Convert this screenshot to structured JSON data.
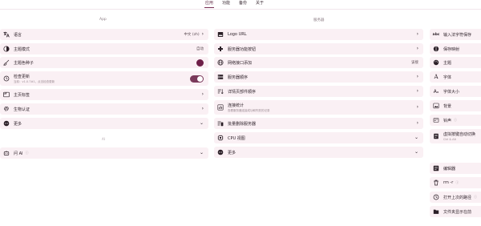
{
  "tabs": [
    {
      "label": "应用",
      "active": true
    },
    {
      "label": "功能"
    },
    {
      "label": "备份"
    },
    {
      "label": "关于"
    }
  ],
  "columns": {
    "left_title": "App",
    "middle_title": "服务器"
  },
  "left": {
    "language": {
      "label": "语言",
      "value": "中文 (zh)"
    },
    "theme_mode": {
      "label": "主题模式",
      "value": "自动"
    },
    "theme_color": {
      "label": "主题色种子",
      "color": "#6e1f48"
    },
    "check_update": {
      "label": "检查更新",
      "sub": "当前：v1.0.7#1，点击检查更新",
      "enabled": true
    },
    "home_tab": {
      "label": "主页标签"
    },
    "bio_auth": {
      "label": "生物认证"
    },
    "more": {
      "label": "更多"
    },
    "divider_text": "AI",
    "ai": {
      "label": "问 AI",
      "help": "ⓘ"
    }
  },
  "middle": {
    "logo_url": {
      "label": "Logo URL"
    },
    "server_functions": {
      "label": "服务器功能按钮"
    },
    "net_iface": {
      "label": "网络接口添加",
      "value": "该接"
    },
    "server_order": {
      "label": "服务器顺序"
    },
    "detail_order": {
      "label": "详情页部件顺序"
    },
    "history": {
      "label": "连接统计",
      "sub": "查看服务器连接成功和失败的记录"
    },
    "batch_delete": {
      "label": "批量删除服务器"
    },
    "cpu_view": {
      "label": "CPU 视图"
    },
    "more": {
      "label": "更多"
    }
  },
  "right": {
    "items": [
      {
        "label": "输入法字符保存",
        "icon": "abc-icon"
      },
      {
        "label": "保存映射",
        "icon": "map-icon"
      },
      {
        "label": "主题",
        "icon": "palette-icon"
      },
      {
        "label": "字体",
        "icon": "font-icon"
      },
      {
        "label": "字体大小",
        "icon": "font-size-icon"
      },
      {
        "label": "背景",
        "icon": "image-icon"
      },
      {
        "label": "铃声",
        "icon": "bell-icon",
        "help": "ⓘ"
      },
      {
        "label": "虚拟按键自动切换",
        "icon": "keyboard-icon",
        "sub": "Ctrl & Alt"
      },
      {
        "label": "编辑器",
        "icon": "editor-icon"
      },
      {
        "label": "rm -r",
        "icon": "trash-icon",
        "help": "ⓘ"
      },
      {
        "label": "打开上次的路径",
        "icon": "history-icon",
        "help": "ⓘ"
      },
      {
        "label": "文件夹显示在前",
        "icon": "folder-icon"
      }
    ]
  }
}
